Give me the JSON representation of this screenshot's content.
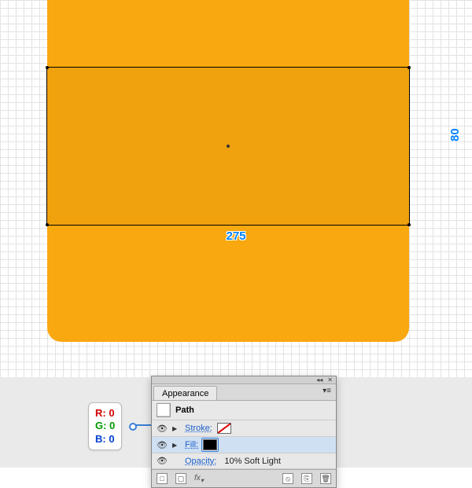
{
  "canvas": {
    "width_label": "275",
    "height_label": "80"
  },
  "rgb": {
    "r_label": "R: 0",
    "g_label": "G: 0",
    "b_label": "B: 0"
  },
  "panel": {
    "tab": "Appearance",
    "flyout": "▾≡",
    "object": "Path",
    "stroke_label": "Stroke:",
    "fill_label": "Fill:",
    "opacity_label": "Opacity:",
    "opacity_value": "10% Soft Light",
    "vis_icon": "👁",
    "fx_label": "fx"
  },
  "colors": {
    "shape": "#f9a80f"
  }
}
